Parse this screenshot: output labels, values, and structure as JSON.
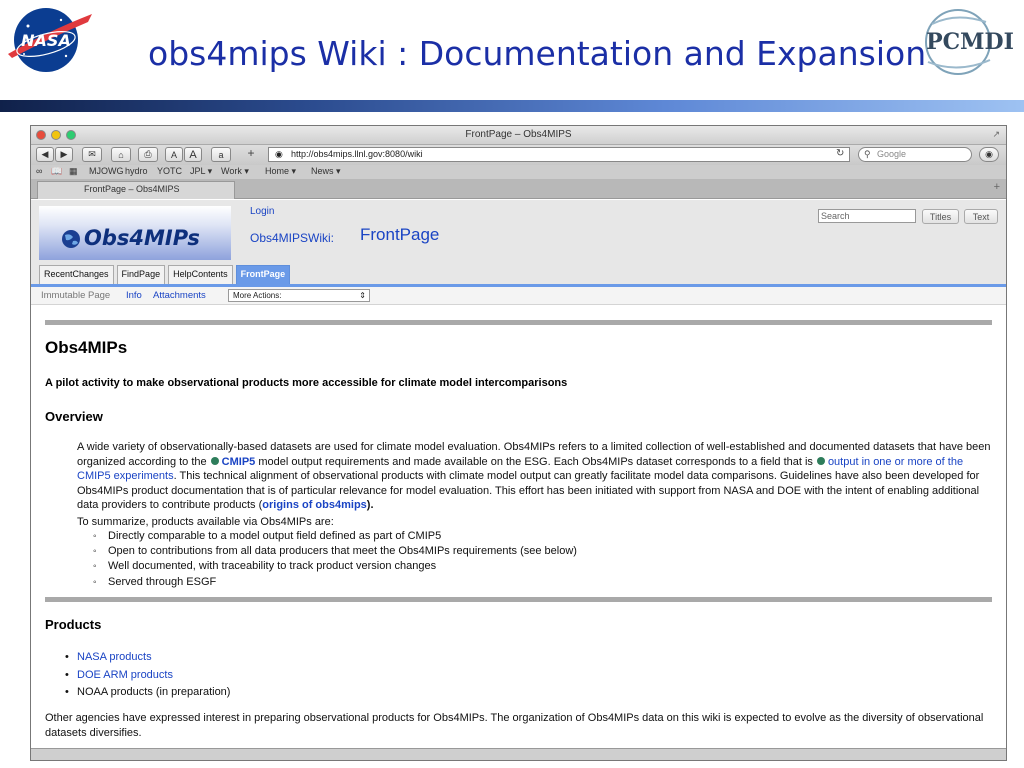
{
  "slide": {
    "title": "obs4mips Wiki : Documentation and Expansion",
    "nasa_logo_text": "NASA",
    "pcmdi_logo_text": "PCMDI"
  },
  "browser": {
    "window_title": "FrontPage – Obs4MIPS",
    "url": "http://obs4mips.llnl.gov:8080/wiki",
    "search_placeholder": "Google",
    "bookmarks": [
      "MJOWG",
      "hydro",
      "YOTC",
      "JPL ▾",
      "Work ▾",
      "Home ▾",
      "News ▾"
    ],
    "tab_title": "FrontPage – Obs4MIPS",
    "toolbar": {
      "font_small": "A",
      "font_large": "A",
      "plus": "+"
    }
  },
  "wiki": {
    "logo_text": "Obs4MIPs",
    "login": "Login",
    "wiki_name": "Obs4MIPSWiki:",
    "page_name": "FrontPage",
    "search_placeholder": "Search",
    "titles_btn": "Titles",
    "text_btn": "Text",
    "nav_tabs": [
      "RecentChanges",
      "FindPage",
      "HelpContents",
      "FrontPage"
    ],
    "actions": {
      "immutable": "Immutable Page",
      "info": "Info",
      "attachments": "Attachments",
      "more_actions": "More Actions:"
    }
  },
  "content": {
    "heading": "Obs4MIPs",
    "subtitle": "A pilot activity to make observational products more accessible for climate model intercomparisons",
    "overview_heading": "Overview",
    "overview": {
      "p1": "A wide variety of observationally-based datasets are used for climate model evaluation. Obs4MIPs refers to a limited collection of well-established and documented datasets that have been organized according to the",
      "cmip5_link": "CMIP5",
      "p2": "model output requirements and made available on the ESG. Each Obs4MIPs dataset corresponds to a field that is",
      "experiments_link": "output in one or more of the CMIP5 experiments",
      "p3": ". This technical alignment of observational products with climate model output can greatly facilitate model data comparisons. Guidelines have also been developed for Obs4MIPs product documentation that is of particular relevance for model evaluation. This effort has been initiated with support from NASA and DOE with the intent of enabling additional data providers to contribute products (",
      "origins_link": "origins of obs4mips",
      "p4": ")."
    },
    "summary_intro": "To summarize, products available via Obs4MIPs are:",
    "summary_items": [
      "Directly comparable to a model output field defined as part of CMIP5",
      "Open to contributions from all data producers that meet the Obs4MIPs requirements (see below)",
      "Well documented, with traceability to track product version changes",
      "Served through ESGF"
    ],
    "products_heading": "Products",
    "products": [
      {
        "label": "NASA products",
        "link": true
      },
      {
        "label": "DOE ARM products",
        "link": true
      },
      {
        "label": "NOAA products (in preparation)",
        "link": false
      }
    ],
    "footer": "Other agencies have expressed interest in preparing observational products for Obs4MIPs. The organization of Obs4MIPs data on this wiki is expected to evolve as the diversity of observational datasets diversifies."
  },
  "colors": {
    "title_blue": "#1b2fa6",
    "link_blue": "#1a44c4",
    "tab_active": "#6a9ae8"
  }
}
